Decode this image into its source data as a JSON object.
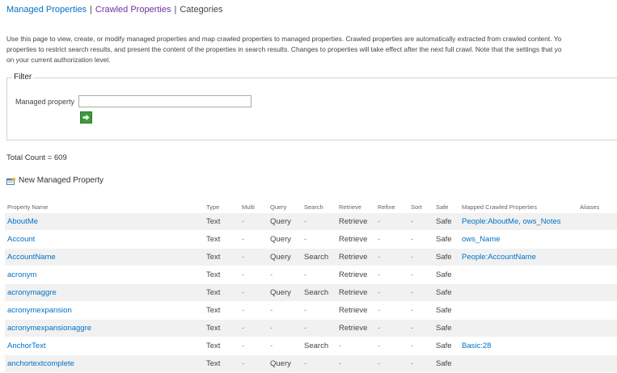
{
  "nav": {
    "managed": "Managed Properties",
    "crawled": "Crawled Properties",
    "categories": "Categories",
    "separator": "|"
  },
  "description": {
    "line1": "Use this page to view, create, or modify managed properties and map crawled properties to managed properties. Crawled properties are automatically extracted from crawled content. Yo",
    "line2": "properties to restrict search results, and present the content of the properties in search results. Changes to properties will take effect after the next full crawl. Note that the settings that yo",
    "line3": "on your current authorization level."
  },
  "filter": {
    "legend": "Filter",
    "label": "Managed property",
    "value": "",
    "go_icon": "go-arrow-icon"
  },
  "total_count": "Total Count = 609",
  "new_property": {
    "label": "New Managed Property",
    "icon": "new-property-icon"
  },
  "table": {
    "headers": [
      "Property Name",
      "Type",
      "Multi",
      "Query",
      "Search",
      "Retrieve",
      "Refine",
      "Sort",
      "Safe",
      "Mapped Crawled Properties",
      "Aliases"
    ],
    "rows": [
      {
        "name": "AboutMe",
        "type": "Text",
        "multi": "-",
        "query": "Query",
        "search": "-",
        "retrieve": "Retrieve",
        "refine": "-",
        "sort": "-",
        "safe": "Safe",
        "mapped": "People:AboutMe, ows_Notes",
        "aliases": ""
      },
      {
        "name": "Account",
        "type": "Text",
        "multi": "-",
        "query": "Query",
        "search": "-",
        "retrieve": "Retrieve",
        "refine": "-",
        "sort": "-",
        "safe": "Safe",
        "mapped": "ows_Name",
        "aliases": ""
      },
      {
        "name": "AccountName",
        "type": "Text",
        "multi": "-",
        "query": "Query",
        "search": "Search",
        "retrieve": "Retrieve",
        "refine": "-",
        "sort": "-",
        "safe": "Safe",
        "mapped": "People:AccountName",
        "aliases": ""
      },
      {
        "name": "acronym",
        "type": "Text",
        "multi": "-",
        "query": "-",
        "search": "-",
        "retrieve": "Retrieve",
        "refine": "-",
        "sort": "-",
        "safe": "Safe",
        "mapped": "",
        "aliases": ""
      },
      {
        "name": "acronymaggre",
        "type": "Text",
        "multi": "-",
        "query": "Query",
        "search": "Search",
        "retrieve": "Retrieve",
        "refine": "-",
        "sort": "-",
        "safe": "Safe",
        "mapped": "",
        "aliases": ""
      },
      {
        "name": "acronymexpansion",
        "type": "Text",
        "multi": "-",
        "query": "-",
        "search": "-",
        "retrieve": "Retrieve",
        "refine": "-",
        "sort": "-",
        "safe": "Safe",
        "mapped": "",
        "aliases": ""
      },
      {
        "name": "acronymexpansionaggre",
        "type": "Text",
        "multi": "-",
        "query": "-",
        "search": "-",
        "retrieve": "Retrieve",
        "refine": "-",
        "sort": "-",
        "safe": "Safe",
        "mapped": "",
        "aliases": ""
      },
      {
        "name": "AnchorText",
        "type": "Text",
        "multi": "-",
        "query": "-",
        "search": "Search",
        "retrieve": "-",
        "refine": "-",
        "sort": "-",
        "safe": "Safe",
        "mapped": "Basic:28",
        "aliases": ""
      },
      {
        "name": "anchortextcomplete",
        "type": "Text",
        "multi": "-",
        "query": "Query",
        "search": "-",
        "retrieve": "-",
        "refine": "-",
        "sort": "-",
        "safe": "Safe",
        "mapped": "",
        "aliases": ""
      }
    ]
  }
}
